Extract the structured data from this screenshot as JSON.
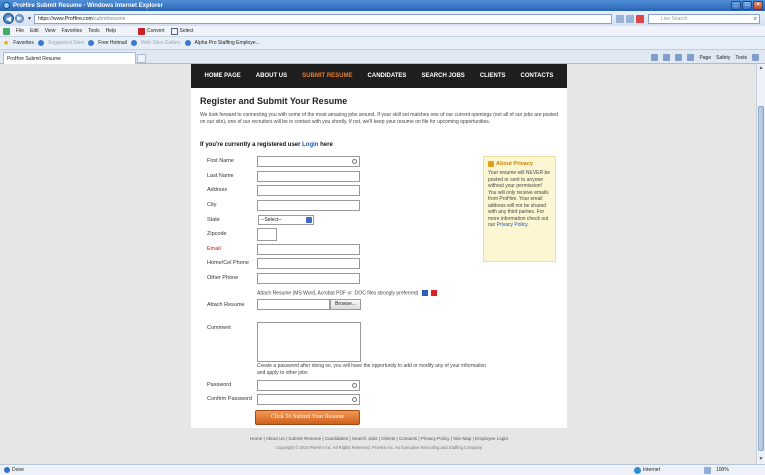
{
  "browser": {
    "window_title": "ProHire Submit Resume - Windows Internet Explorer",
    "address_host": "ProHire.com",
    "address_path": "/submitresume",
    "address_prefix": "https://www.",
    "search_placeholder": "Live Search",
    "menu": [
      "File",
      "Edit",
      "View",
      "Favorites",
      "Tools",
      "Help"
    ],
    "convert_label": "Convert",
    "select_label": "Select",
    "favorites_label": "Favorites",
    "favorites_items": [
      "Suggested Sites",
      "Free Hotmail",
      "Web Slice Gallery",
      "Alpha Pro Staffing Employe..."
    ],
    "tab_title": "ProHire Submit Resume",
    "command_bar": [
      "Page",
      "Safety",
      "Tools"
    ],
    "status_text": "Done",
    "zone_text": "Internet",
    "zoom_text": "100%"
  },
  "site_nav": [
    {
      "label": "HOME PAGE",
      "active": false
    },
    {
      "label": "ABOUT US",
      "active": false
    },
    {
      "label": "SUBMIT RESUME",
      "active": true
    },
    {
      "label": "CANDIDATES",
      "active": false
    },
    {
      "label": "SEARCH JOBS",
      "active": false
    },
    {
      "label": "CLIENTS",
      "active": false
    },
    {
      "label": "CONTACTS",
      "active": false
    }
  ],
  "page": {
    "title": "Register and Submit Your Resume",
    "intro": "We look forward to connecting you with some of the most amazing jobs around. If your skill set matches one of our current openings (not all of our jobs are posted on our site), one of our recruiters will be in contact with you shortly. If not, we'll keep your resume on file for upcoming opportunities.",
    "registered_prefix": "If you're currently a registered user",
    "registered_link": "Login",
    "registered_suffix": "here"
  },
  "form": {
    "first_name_label": "First Name",
    "last_name_label": "Last Name",
    "address_label": "Address",
    "city_label": "City",
    "state_label": "State",
    "state_value": "--Select--",
    "zipcode_label": "Zipcode",
    "email_label": "Email",
    "home_phone_label": "Home/Cel Phone",
    "other_phone_label": "Other Phone",
    "attach_note": "Attach Resume (MS Word, Acrobat PDF or .DOC files strongly preferred)",
    "attach_label": "Attach Resume",
    "browse_label": "Browse...",
    "comment_label": "Comment",
    "password_note": "Create a password after doing so, you will have the opportunity to add or modify any of your information and apply to other jobs",
    "password_label": "Password",
    "confirm_password_label": "Confirm Password",
    "submit_label": "Click To Submit Your Resume"
  },
  "privacy": {
    "title": "About Privacy",
    "body": "Your resume will NEVER be posted or sent to anyone without your permission! You will only receive emails from ProHire. Your email address will not be shared with any third parties. For more information check out our",
    "link": "Privacy Policy",
    "end": "."
  },
  "footer": {
    "links": [
      "Home",
      "About Us",
      "Submit Resume",
      "Candidates",
      "Search Jobs",
      "Clients",
      "Contacts",
      "Privacy Policy",
      "Site Map",
      "Employee Login"
    ],
    "copyright": "Copyright © 2010 ProHire Inc. All Rights Reserved. ProHire Inc. An Executive Recruiting and Staffing Company"
  }
}
